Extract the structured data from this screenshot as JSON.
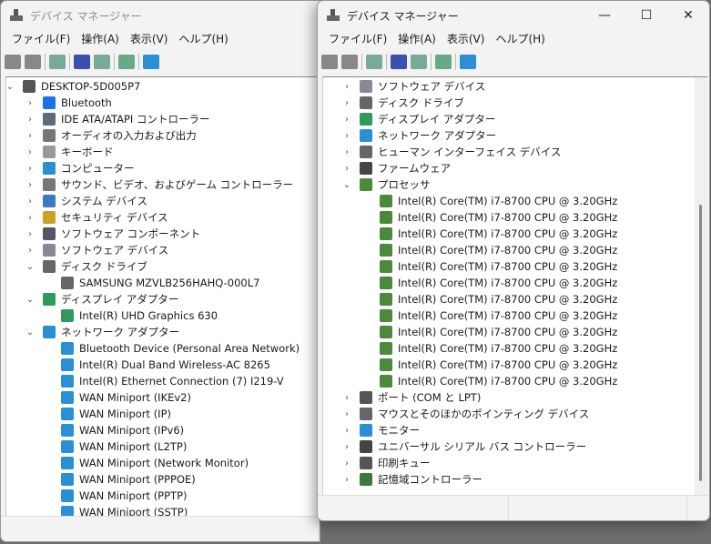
{
  "window_title": "デバイス マネージャー",
  "menu": [
    "ファイル(F)",
    "操作(A)",
    "表示(V)",
    "ヘルプ(H)"
  ],
  "controls": {
    "minimize": "—",
    "maximize": "☐",
    "close": "✕"
  },
  "left_tree": [
    {
      "label": "DESKTOP-5D005P7",
      "level": 0,
      "exp": "open",
      "icon": "computer-icon",
      "color": "#555"
    },
    {
      "label": "Bluetooth",
      "level": 1,
      "exp": "closed",
      "icon": "bluetooth-icon",
      "color": "#1a73e8"
    },
    {
      "label": "IDE ATA/ATAPI コントローラー",
      "level": 1,
      "exp": "closed",
      "icon": "ide-controller-icon",
      "color": "#5a6b7a"
    },
    {
      "label": "オーディオの入力および出力",
      "level": 1,
      "exp": "closed",
      "icon": "speaker-icon",
      "color": "#777"
    },
    {
      "label": "キーボード",
      "level": 1,
      "exp": "closed",
      "icon": "keyboard-icon",
      "color": "#999"
    },
    {
      "label": "コンピューター",
      "level": 1,
      "exp": "closed",
      "icon": "monitor-icon",
      "color": "#2b8fd6"
    },
    {
      "label": "サウンド、ビデオ、およびゲーム コントローラー",
      "level": 1,
      "exp": "closed",
      "icon": "sound-icon",
      "color": "#777"
    },
    {
      "label": "システム デバイス",
      "level": 1,
      "exp": "closed",
      "icon": "system-device-icon",
      "color": "#3b7bbf"
    },
    {
      "label": "セキュリティ デバイス",
      "level": 1,
      "exp": "closed",
      "icon": "security-icon",
      "color": "#c9a227"
    },
    {
      "label": "ソフトウェア コンポーネント",
      "level": 1,
      "exp": "closed",
      "icon": "software-component-icon",
      "color": "#556"
    },
    {
      "label": "ソフトウェア デバイス",
      "level": 1,
      "exp": "closed",
      "icon": "software-device-icon",
      "color": "#889"
    },
    {
      "label": "ディスク ドライブ",
      "level": 1,
      "exp": "open",
      "icon": "disk-icon",
      "color": "#666"
    },
    {
      "label": "SAMSUNG MZVLB256HAHQ-000L7",
      "level": 2,
      "exp": "",
      "icon": "disk-icon",
      "color": "#666"
    },
    {
      "label": "ディスプレイ アダプター",
      "level": 1,
      "exp": "open",
      "icon": "display-adapter-icon",
      "color": "#2f9a5a"
    },
    {
      "label": "Intel(R) UHD Graphics 630",
      "level": 2,
      "exp": "",
      "icon": "display-adapter-icon",
      "color": "#2f9a5a"
    },
    {
      "label": "ネットワーク アダプター",
      "level": 1,
      "exp": "open",
      "icon": "network-icon",
      "color": "#2b8fd6"
    },
    {
      "label": "Bluetooth Device (Personal Area Network)",
      "level": 2,
      "exp": "",
      "icon": "network-icon",
      "color": "#2b8fd6"
    },
    {
      "label": "Intel(R) Dual Band Wireless-AC 8265",
      "level": 2,
      "exp": "",
      "icon": "network-icon",
      "color": "#2b8fd6"
    },
    {
      "label": "Intel(R) Ethernet Connection (7) I219-V",
      "level": 2,
      "exp": "",
      "icon": "network-icon",
      "color": "#2b8fd6"
    },
    {
      "label": "WAN Miniport (IKEv2)",
      "level": 2,
      "exp": "",
      "icon": "network-icon",
      "color": "#2b8fd6"
    },
    {
      "label": "WAN Miniport (IP)",
      "level": 2,
      "exp": "",
      "icon": "network-icon",
      "color": "#2b8fd6"
    },
    {
      "label": "WAN Miniport (IPv6)",
      "level": 2,
      "exp": "",
      "icon": "network-icon",
      "color": "#2b8fd6"
    },
    {
      "label": "WAN Miniport (L2TP)",
      "level": 2,
      "exp": "",
      "icon": "network-icon",
      "color": "#2b8fd6"
    },
    {
      "label": "WAN Miniport (Network Monitor)",
      "level": 2,
      "exp": "",
      "icon": "network-icon",
      "color": "#2b8fd6"
    },
    {
      "label": "WAN Miniport (PPPOE)",
      "level": 2,
      "exp": "",
      "icon": "network-icon",
      "color": "#2b8fd6"
    },
    {
      "label": "WAN Miniport (PPTP)",
      "level": 2,
      "exp": "",
      "icon": "network-icon",
      "color": "#2b8fd6"
    },
    {
      "label": "WAN Miniport (SSTP)",
      "level": 2,
      "exp": "",
      "icon": "network-icon",
      "color": "#2b8fd6"
    }
  ],
  "right_tree": [
    {
      "label": "ソフトウェア デバイス",
      "level": 1,
      "exp": "closed",
      "icon": "software-device-icon",
      "color": "#889"
    },
    {
      "label": "ディスク ドライブ",
      "level": 1,
      "exp": "closed",
      "icon": "disk-icon",
      "color": "#666"
    },
    {
      "label": "ディスプレイ アダプター",
      "level": 1,
      "exp": "closed",
      "icon": "display-adapter-icon",
      "color": "#2f9a5a"
    },
    {
      "label": "ネットワーク アダプター",
      "level": 1,
      "exp": "closed",
      "icon": "network-icon",
      "color": "#2b8fd6"
    },
    {
      "label": "ヒューマン インターフェイス デバイス",
      "level": 1,
      "exp": "closed",
      "icon": "hid-icon",
      "color": "#666"
    },
    {
      "label": "ファームウェア",
      "level": 1,
      "exp": "closed",
      "icon": "firmware-icon",
      "color": "#444"
    },
    {
      "label": "プロセッサ",
      "level": 1,
      "exp": "open",
      "icon": "processor-icon",
      "color": "#4a8a3a"
    },
    {
      "label": "Intel(R) Core(TM) i7-8700 CPU @ 3.20GHz",
      "level": 2,
      "exp": "",
      "icon": "processor-icon",
      "color": "#4a8a3a"
    },
    {
      "label": "Intel(R) Core(TM) i7-8700 CPU @ 3.20GHz",
      "level": 2,
      "exp": "",
      "icon": "processor-icon",
      "color": "#4a8a3a"
    },
    {
      "label": "Intel(R) Core(TM) i7-8700 CPU @ 3.20GHz",
      "level": 2,
      "exp": "",
      "icon": "processor-icon",
      "color": "#4a8a3a"
    },
    {
      "label": "Intel(R) Core(TM) i7-8700 CPU @ 3.20GHz",
      "level": 2,
      "exp": "",
      "icon": "processor-icon",
      "color": "#4a8a3a"
    },
    {
      "label": "Intel(R) Core(TM) i7-8700 CPU @ 3.20GHz",
      "level": 2,
      "exp": "",
      "icon": "processor-icon",
      "color": "#4a8a3a"
    },
    {
      "label": "Intel(R) Core(TM) i7-8700 CPU @ 3.20GHz",
      "level": 2,
      "exp": "",
      "icon": "processor-icon",
      "color": "#4a8a3a"
    },
    {
      "label": "Intel(R) Core(TM) i7-8700 CPU @ 3.20GHz",
      "level": 2,
      "exp": "",
      "icon": "processor-icon",
      "color": "#4a8a3a"
    },
    {
      "label": "Intel(R) Core(TM) i7-8700 CPU @ 3.20GHz",
      "level": 2,
      "exp": "",
      "icon": "processor-icon",
      "color": "#4a8a3a"
    },
    {
      "label": "Intel(R) Core(TM) i7-8700 CPU @ 3.20GHz",
      "level": 2,
      "exp": "",
      "icon": "processor-icon",
      "color": "#4a8a3a"
    },
    {
      "label": "Intel(R) Core(TM) i7-8700 CPU @ 3.20GHz",
      "level": 2,
      "exp": "",
      "icon": "processor-icon",
      "color": "#4a8a3a"
    },
    {
      "label": "Intel(R) Core(TM) i7-8700 CPU @ 3.20GHz",
      "level": 2,
      "exp": "",
      "icon": "processor-icon",
      "color": "#4a8a3a"
    },
    {
      "label": "Intel(R) Core(TM) i7-8700 CPU @ 3.20GHz",
      "level": 2,
      "exp": "",
      "icon": "processor-icon",
      "color": "#4a8a3a"
    },
    {
      "label": "ポート (COM と LPT)",
      "level": 1,
      "exp": "closed",
      "icon": "port-icon",
      "color": "#555"
    },
    {
      "label": "マウスとそのほかのポインティング デバイス",
      "level": 1,
      "exp": "closed",
      "icon": "mouse-icon",
      "color": "#666"
    },
    {
      "label": "モニター",
      "level": 1,
      "exp": "closed",
      "icon": "monitor-icon",
      "color": "#2b8fd6"
    },
    {
      "label": "ユニバーサル シリアル バス コントローラー",
      "level": 1,
      "exp": "closed",
      "icon": "usb-icon",
      "color": "#444"
    },
    {
      "label": "印刷キュー",
      "level": 1,
      "exp": "closed",
      "icon": "printer-icon",
      "color": "#555"
    },
    {
      "label": "記憶域コントローラー",
      "level": 1,
      "exp": "closed",
      "icon": "storage-controller-icon",
      "color": "#3a7a3a"
    }
  ],
  "scrollbar": {
    "right_position_fraction": 0.45
  }
}
